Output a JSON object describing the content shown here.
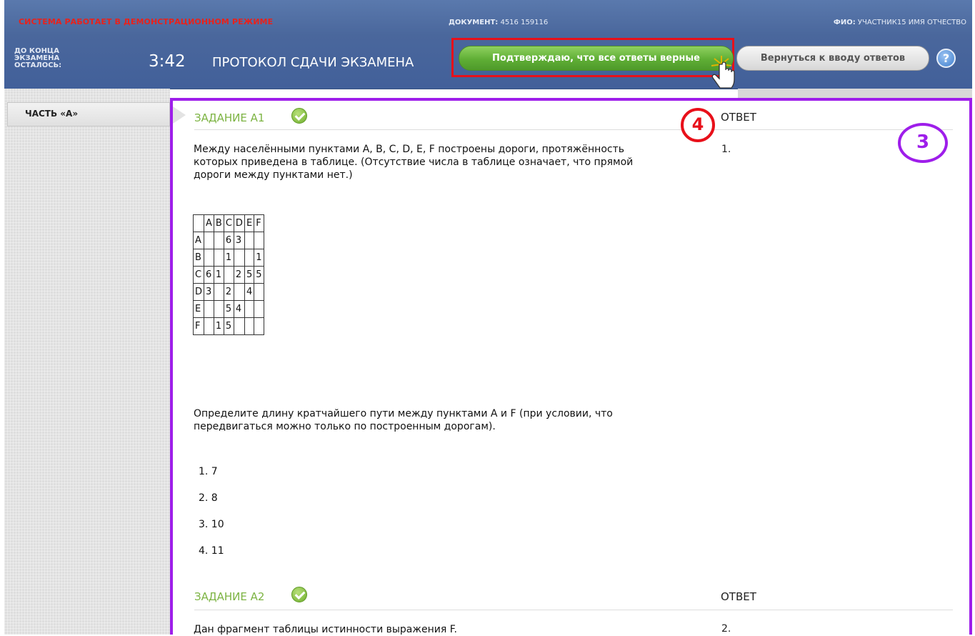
{
  "header": {
    "demo_notice": "СИСТЕМА РАБОТАЕТ В ДЕМОНСТРАЦИОННОМ РЕЖИМЕ",
    "document_label": "ДОКУМЕНТ:",
    "document_value": "4516 159116",
    "fio_label": "ФИО:",
    "fio_value": "УЧАСТНИК15 ИМЯ ОТЧЕСТВО",
    "time_left_label": "ДО КОНЦА ЭКЗАМЕНА ОСТАЛОСЬ:",
    "timer": "3:42",
    "title": "ПРОТОКОЛ СДАЧИ ЭКЗАМЕНА",
    "confirm_button": "Подтверждаю, что все ответы верные",
    "back_button": "Вернуться к вводу ответов",
    "help_icon": "?"
  },
  "sidebar": {
    "part_label": "ЧАСТЬ «А»"
  },
  "colors": {
    "accent_purple": "#9e1eea",
    "accent_red": "#e8101a",
    "header_blue": "#4a679c",
    "task_green": "#7cb342"
  },
  "annotations": {
    "step_4": "4",
    "step_3": "3"
  },
  "tasks": [
    {
      "title": "ЗАДАНИЕ А1",
      "answer_header": "ОТВЕТ",
      "answer": "1.",
      "question_intro": "Между населёнными пунктами A, B, C, D, E, F построены дороги, протяжённость которых приведена в таблице. (Отсутствие числа в таблице означает, что прямой дороги между пунктами нет.)",
      "table": {
        "header": [
          "",
          "A",
          "B",
          "C",
          "D",
          "E",
          "F"
        ],
        "rows": [
          [
            "A",
            "",
            "",
            "6",
            "3",
            "",
            ""
          ],
          [
            "B",
            "",
            "",
            "1",
            "",
            "",
            "1"
          ],
          [
            "C",
            "6",
            "1",
            "",
            "2",
            "5",
            "5"
          ],
          [
            "D",
            "3",
            "",
            "2",
            "",
            "4",
            ""
          ],
          [
            "E",
            "",
            "",
            "5",
            "4",
            "",
            ""
          ],
          [
            "F",
            "",
            "1",
            "5",
            "",
            "",
            ""
          ]
        ]
      },
      "question": "Определите длину кратчайшего пути между пунктами A и F (при условии, что передвигаться можно только по построенным дорогам).",
      "options": [
        "1.  7",
        "2.  8",
        "3.  10",
        "4.  11"
      ]
    },
    {
      "title": "ЗАДАНИЕ А2",
      "answer_header": "ОТВЕТ",
      "answer": "2.",
      "question_intro": "Дан фрагмент таблицы истинности выражения F."
    }
  ]
}
